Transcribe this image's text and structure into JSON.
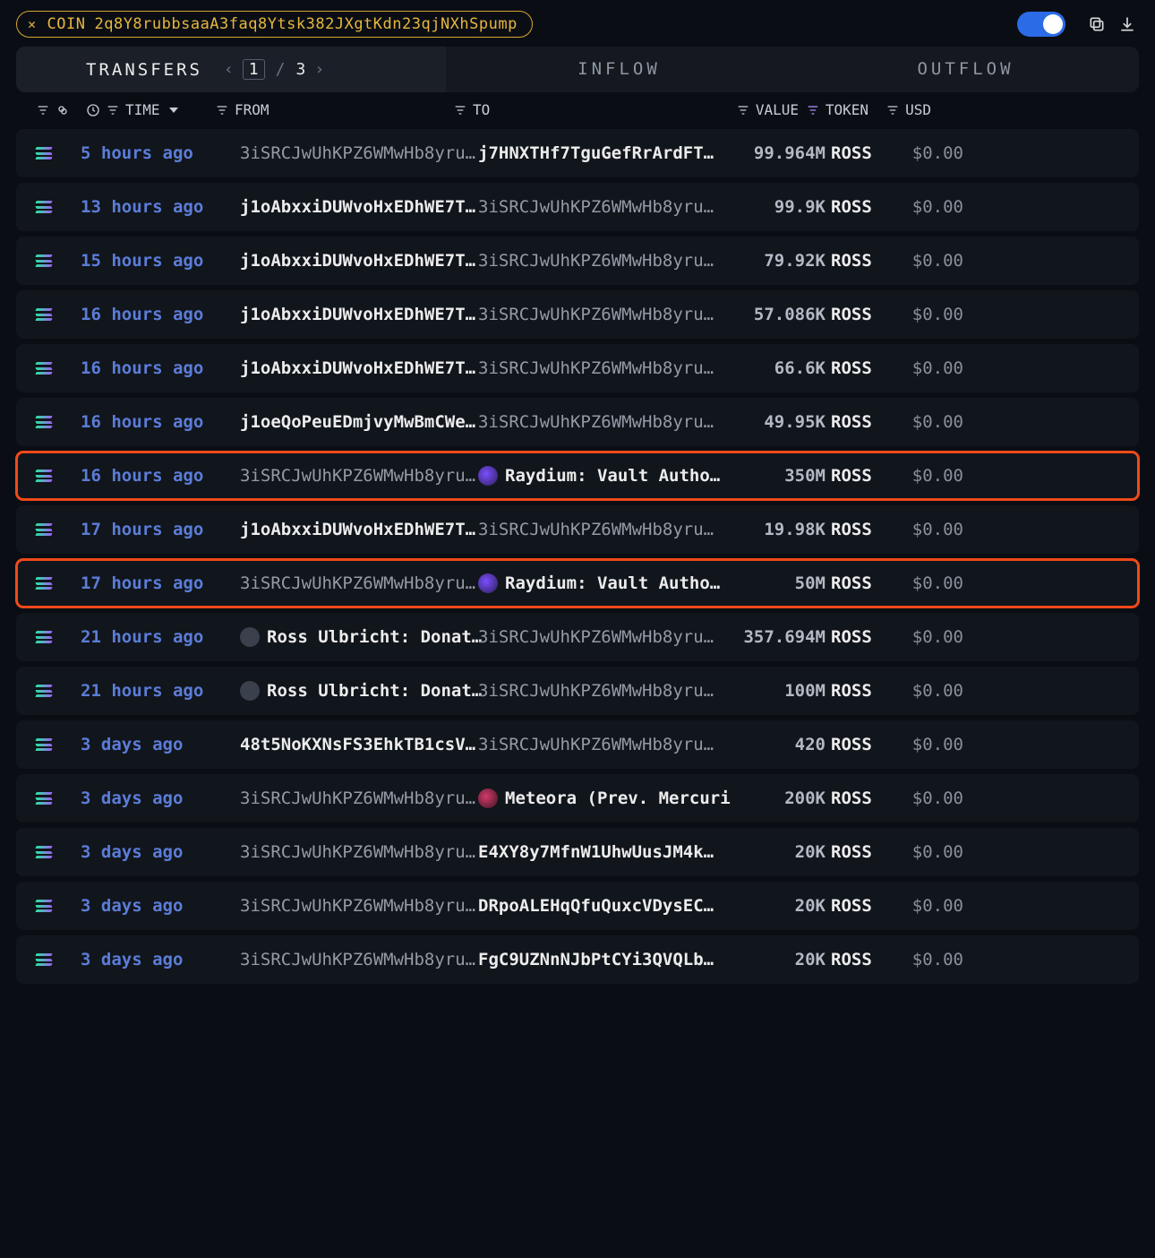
{
  "header": {
    "coin_prefix": "COIN",
    "coin_address": "2q8Y8rubbsaaA3faq8Ytsk382JXgtKdn23qjNXhSpump"
  },
  "tabs": {
    "transfers": "TRANSFERS",
    "inflow": "INFLOW",
    "outflow": "OUTFLOW",
    "pager": {
      "current": "1",
      "sep": "/",
      "total": "3"
    }
  },
  "columns": {
    "time": "TIME",
    "from": "FROM",
    "to": "TO",
    "value": "VALUE",
    "token": "TOKEN",
    "usd": "USD"
  },
  "rows": [
    {
      "time": "5 hours ago",
      "from": "3iSRCJwUhKPZ6WMwHb8yru…",
      "from_style": "dim",
      "to": "j7HNXTHf7TguGefRrArdFT…",
      "to_style": "strong",
      "to_icon": "",
      "value": "99.964M",
      "token": "ROSS",
      "usd": "$0.00",
      "hl": false
    },
    {
      "time": "13 hours ago",
      "from": "j1oAbxxiDUWvoHxEDhWE7T…",
      "from_style": "strong",
      "to": "3iSRCJwUhKPZ6WMwHb8yru…",
      "to_style": "dim",
      "to_icon": "",
      "value": "99.9K",
      "token": "ROSS",
      "usd": "$0.00",
      "hl": false
    },
    {
      "time": "15 hours ago",
      "from": "j1oAbxxiDUWvoHxEDhWE7T…",
      "from_style": "strong",
      "to": "3iSRCJwUhKPZ6WMwHb8yru…",
      "to_style": "dim",
      "to_icon": "",
      "value": "79.92K",
      "token": "ROSS",
      "usd": "$0.00",
      "hl": false
    },
    {
      "time": "16 hours ago",
      "from": "j1oAbxxiDUWvoHxEDhWE7T…",
      "from_style": "strong",
      "to": "3iSRCJwUhKPZ6WMwHb8yru…",
      "to_style": "dim",
      "to_icon": "",
      "value": "57.086K",
      "token": "ROSS",
      "usd": "$0.00",
      "hl": false
    },
    {
      "time": "16 hours ago",
      "from": "j1oAbxxiDUWvoHxEDhWE7T…",
      "from_style": "strong",
      "to": "3iSRCJwUhKPZ6WMwHb8yru…",
      "to_style": "dim",
      "to_icon": "",
      "value": "66.6K",
      "token": "ROSS",
      "usd": "$0.00",
      "hl": false
    },
    {
      "time": "16 hours ago",
      "from": "j1oeQoPeuEDmjvyMwBmCWe…",
      "from_style": "strong",
      "to": "3iSRCJwUhKPZ6WMwHb8yru…",
      "to_style": "dim",
      "to_icon": "",
      "value": "49.95K",
      "token": "ROSS",
      "usd": "$0.00",
      "hl": false
    },
    {
      "time": "16 hours ago",
      "from": "3iSRCJwUhKPZ6WMwHb8yru…",
      "from_style": "dim",
      "to": "Raydium: Vault Autho…",
      "to_style": "strong",
      "to_icon": "ray",
      "value": "350M",
      "token": "ROSS",
      "usd": "$0.00",
      "hl": true
    },
    {
      "time": "17 hours ago",
      "from": "j1oAbxxiDUWvoHxEDhWE7T…",
      "from_style": "strong",
      "to": "3iSRCJwUhKPZ6WMwHb8yru…",
      "to_style": "dim",
      "to_icon": "",
      "value": "19.98K",
      "token": "ROSS",
      "usd": "$0.00",
      "hl": false
    },
    {
      "time": "17 hours ago",
      "from": "3iSRCJwUhKPZ6WMwHb8yru…",
      "from_style": "dim",
      "to": "Raydium: Vault Autho…",
      "to_style": "strong",
      "to_icon": "ray",
      "value": "50M",
      "token": "ROSS",
      "usd": "$0.00",
      "hl": true
    },
    {
      "time": "21 hours ago",
      "from": "Ross Ulbricht: Donat…",
      "from_style": "strong",
      "from_icon": "avatar",
      "to": "3iSRCJwUhKPZ6WMwHb8yru…",
      "to_style": "dim",
      "to_icon": "",
      "value": "357.694M",
      "token": "ROSS",
      "usd": "$0.00",
      "hl": false
    },
    {
      "time": "21 hours ago",
      "from": "Ross Ulbricht: Donat…",
      "from_style": "strong",
      "from_icon": "avatar",
      "to": "3iSRCJwUhKPZ6WMwHb8yru…",
      "to_style": "dim",
      "to_icon": "",
      "value": "100M",
      "token": "ROSS",
      "usd": "$0.00",
      "hl": false
    },
    {
      "time": "3 days ago",
      "from": "48t5NoKXNsFS3EhkTB1csV…",
      "from_style": "strong",
      "to": "3iSRCJwUhKPZ6WMwHb8yru…",
      "to_style": "dim",
      "to_icon": "",
      "value": "420",
      "token": "ROSS",
      "usd": "$0.00",
      "hl": false
    },
    {
      "time": "3 days ago",
      "from": "3iSRCJwUhKPZ6WMwHb8yru…",
      "from_style": "dim",
      "to": "Meteora (Prev. Mercuri",
      "to_style": "strong",
      "to_icon": "met",
      "value": "200K",
      "token": "ROSS",
      "usd": "$0.00",
      "hl": false
    },
    {
      "time": "3 days ago",
      "from": "3iSRCJwUhKPZ6WMwHb8yru…",
      "from_style": "dim",
      "to": "E4XY8y7MfnW1UhwUusJM4k…",
      "to_style": "strong",
      "to_icon": "",
      "value": "20K",
      "token": "ROSS",
      "usd": "$0.00",
      "hl": false
    },
    {
      "time": "3 days ago",
      "from": "3iSRCJwUhKPZ6WMwHb8yru…",
      "from_style": "dim",
      "to": "DRpoALEHqQfuQuxcVDysEC…",
      "to_style": "strong",
      "to_icon": "",
      "value": "20K",
      "token": "ROSS",
      "usd": "$0.00",
      "hl": false
    },
    {
      "time": "3 days ago",
      "from": "3iSRCJwUhKPZ6WMwHb8yru…",
      "from_style": "dim",
      "to": "FgC9UZNnNJbPtCYi3QVQLb…",
      "to_style": "strong",
      "to_icon": "",
      "value": "20K",
      "token": "ROSS",
      "usd": "$0.00",
      "hl": false
    }
  ]
}
